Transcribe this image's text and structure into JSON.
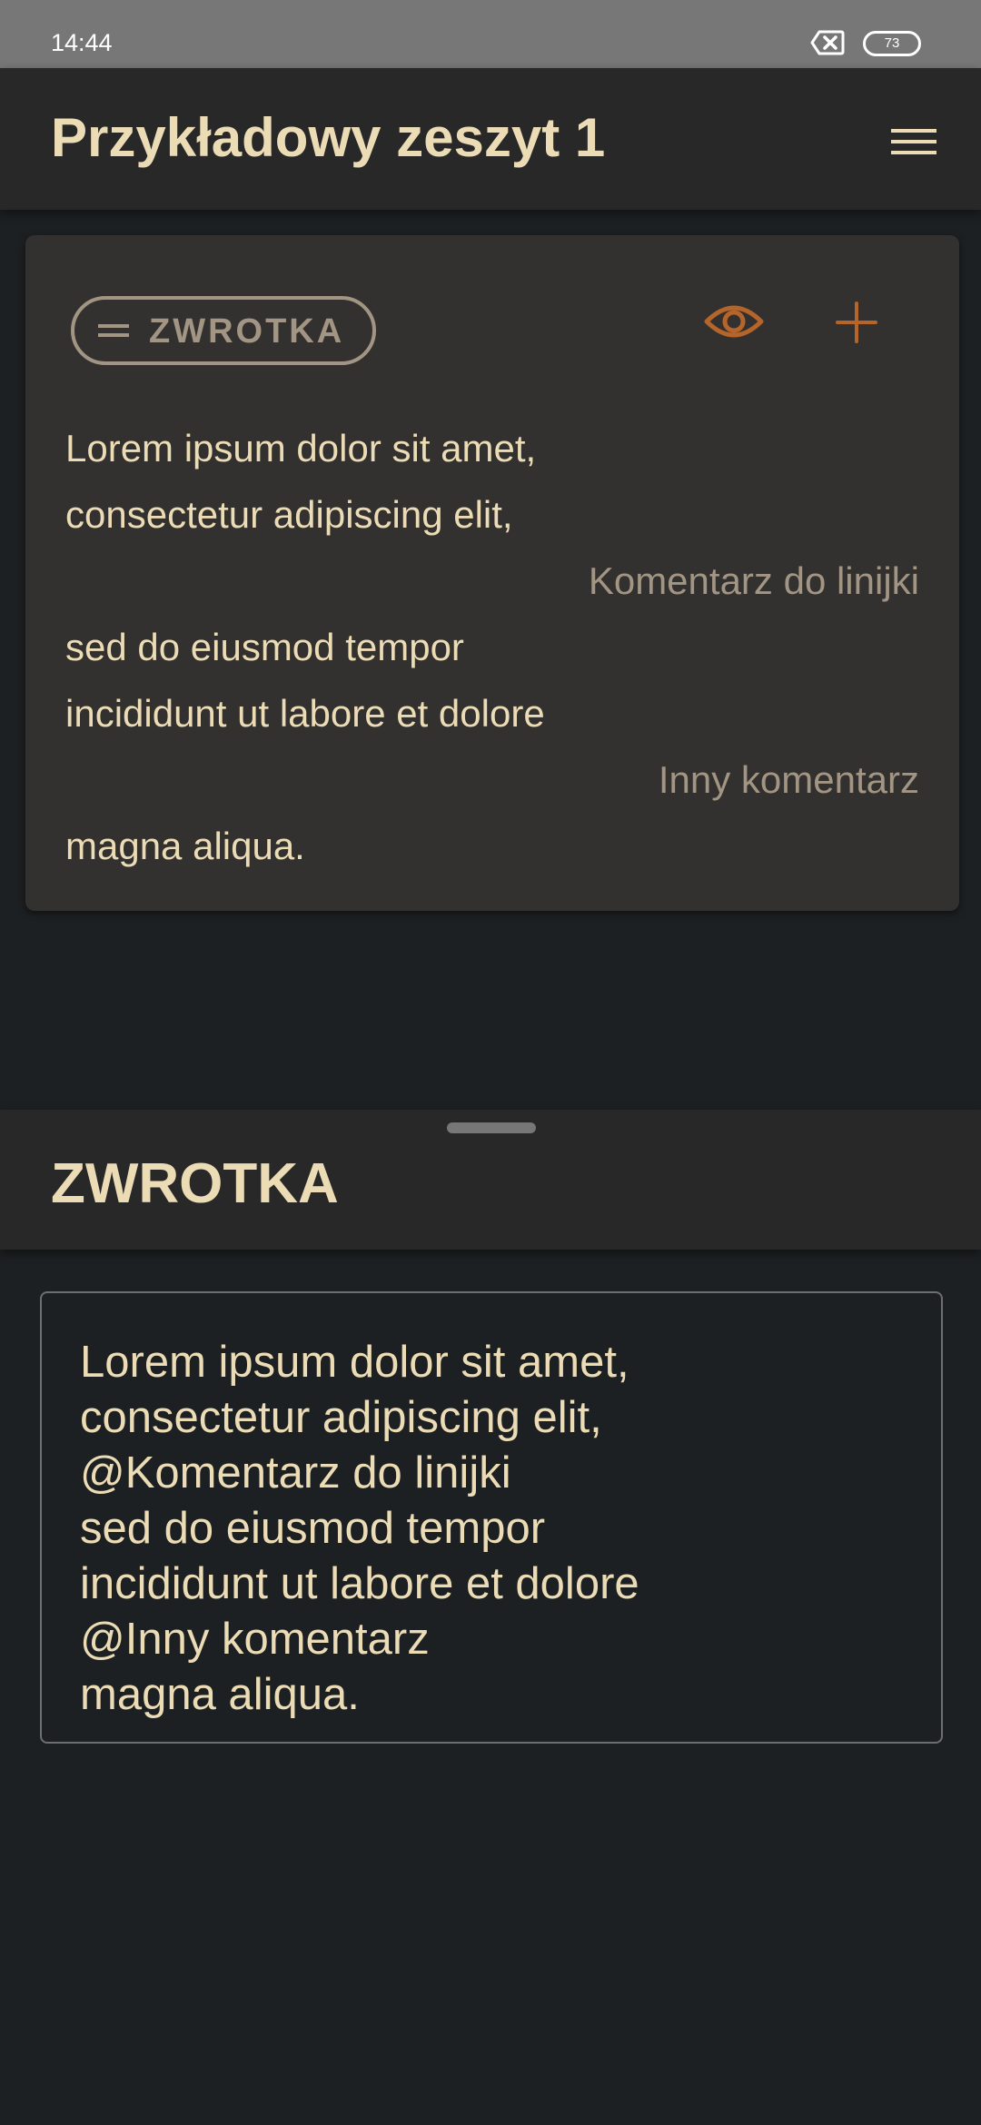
{
  "status_bar": {
    "time": "14:44",
    "battery_level": "73",
    "notification_icon": "close-box-icon"
  },
  "app_bar": {
    "title": "Przykładowy zeszyt 1",
    "menu_icon": "hamburger-menu-icon"
  },
  "card": {
    "chip_label": "ZWROTKA",
    "chip_icon": "drag-handle-icon",
    "actions": [
      "eye-icon",
      "plus-icon"
    ],
    "lines": [
      {
        "text": "Lorem ipsum dolor sit amet,",
        "is_comment": false
      },
      {
        "text": "consectetur adipiscing elit,",
        "is_comment": false
      },
      {
        "text": "Komentarz do linijki",
        "is_comment": true
      },
      {
        "text": "sed do eiusmod tempor",
        "is_comment": false
      },
      {
        "text": "incididunt ut labore et dolore",
        "is_comment": false
      },
      {
        "text": "Inny komentarz",
        "is_comment": true
      },
      {
        "text": "magna aliqua.",
        "is_comment": false
      }
    ]
  },
  "sheet": {
    "title": "ZWROTKA"
  },
  "editor": {
    "lines": [
      "Lorem ipsum dolor sit amet,",
      "consectetur adipiscing elit,",
      "@Komentarz do linijki",
      "sed do eiusmod tempor",
      "incididunt ut labore et dolore",
      "@Inny komentarz",
      "magna aliqua."
    ]
  },
  "colors": {
    "background": "#1d2022",
    "surface": "#282828",
    "card": "#323130",
    "text_primary": "#ecdcb6",
    "text_muted": "#a39583",
    "accent": "#b5652a",
    "status_bar": "#777777"
  }
}
